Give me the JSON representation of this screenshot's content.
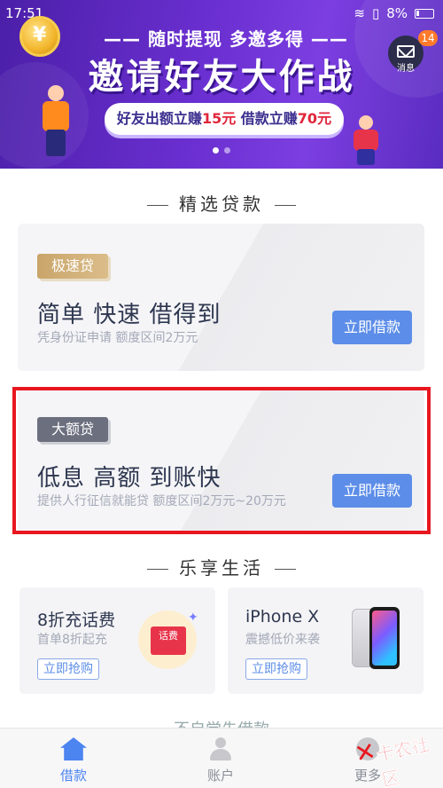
{
  "status_bar": {
    "time": "17:51",
    "battery": "8%"
  },
  "banner": {
    "top_line": "—— 随时提现 多邀多得 ——",
    "title": "邀请好友大作战",
    "pill_prefix": "好友出额立赚",
    "pill_amount1": "15元",
    "pill_mid": " 借款立赚",
    "pill_amount2": "70元",
    "message_label": "消息",
    "message_badge": "14",
    "active_slide": 1,
    "slide_count": 2
  },
  "featured": {
    "section_title": "精选贷款",
    "cards": [
      {
        "tag": "极速贷",
        "title": "简单 快速 借得到",
        "subtitle": "凭身份证申请  额度区间2万元",
        "button": "立即借款"
      },
      {
        "tag": "大额贷",
        "title": "低息 高额 到账快",
        "subtitle": "提供人行征信就能贷  额度区间2万元~20万元",
        "button": "立即借款"
      }
    ]
  },
  "life": {
    "section_title": "乐享生活",
    "cards": [
      {
        "title": "8折充话费",
        "subtitle": "首单8折起充",
        "button": "立即抢购",
        "image_label": "话费",
        "icon": "red-packet-icon"
      },
      {
        "title": "iPhone X",
        "subtitle": "震撼低价来袭",
        "button": "立即抢购",
        "icon": "phone-icon"
      }
    ]
  },
  "partial_row": "不自觉先借款",
  "bottom_nav": [
    {
      "label": "借款",
      "icon": "home-icon",
      "active": true
    },
    {
      "label": "账户",
      "icon": "user-icon",
      "active": false
    },
    {
      "label": "更多",
      "icon": "more-icon",
      "active": false
    }
  ],
  "watermark": "卡农社区",
  "colors": {
    "accent": "#5c8de8",
    "nav_active": "#4c84f0",
    "highlight_frame": "#e8171f",
    "banner_purple": "#6a2fd0"
  }
}
